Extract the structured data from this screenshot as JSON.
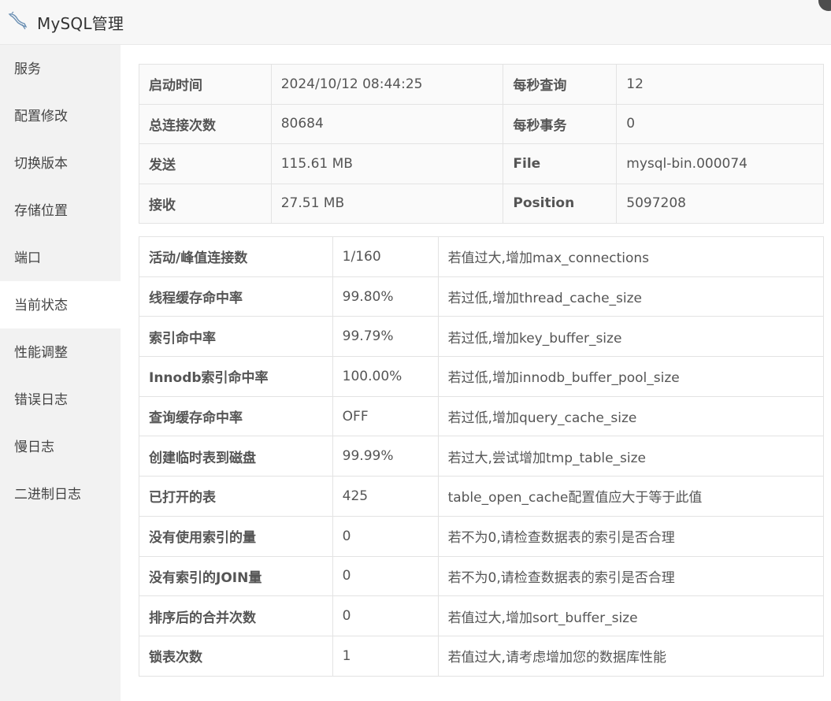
{
  "app": {
    "title": "MySQL管理"
  },
  "sidebar": {
    "items": [
      {
        "label": "服务"
      },
      {
        "label": "配置修改"
      },
      {
        "label": "切换版本"
      },
      {
        "label": "存储位置"
      },
      {
        "label": "端口"
      },
      {
        "label": "当前状态",
        "active": true
      },
      {
        "label": "性能调整"
      },
      {
        "label": "错误日志"
      },
      {
        "label": "慢日志"
      },
      {
        "label": "二进制日志"
      }
    ]
  },
  "summary": {
    "rows": [
      {
        "k1": "启动时间",
        "v1": "2024/10/12 08:44:25",
        "k2": "每秒查询",
        "v2": "12"
      },
      {
        "k1": "总连接次数",
        "v1": "80684",
        "k2": "每秒事务",
        "v2": "0"
      },
      {
        "k1": "发送",
        "v1": "115.61 MB",
        "k2": "File",
        "v2": "mysql-bin.000074"
      },
      {
        "k1": "接收",
        "v1": "27.51 MB",
        "k2": "Position",
        "v2": "5097208"
      }
    ]
  },
  "metrics": {
    "rows": [
      {
        "name": "活动/峰值连接数",
        "value": "1/160",
        "advice": "若值过大,增加max_connections"
      },
      {
        "name": "线程缓存命中率",
        "value": "99.80%",
        "advice": "若过低,增加thread_cache_size"
      },
      {
        "name": "索引命中率",
        "value": "99.79%",
        "advice": "若过低,增加key_buffer_size"
      },
      {
        "name": "Innodb索引命中率",
        "value": "100.00%",
        "advice": "若过低,增加innodb_buffer_pool_size"
      },
      {
        "name": "查询缓存命中率",
        "value": "OFF",
        "advice": "若过低,增加query_cache_size"
      },
      {
        "name": "创建临时表到磁盘",
        "value": "99.99%",
        "advice": "若过大,尝试增加tmp_table_size"
      },
      {
        "name": "已打开的表",
        "value": "425",
        "advice": "table_open_cache配置值应大于等于此值"
      },
      {
        "name": "没有使用索引的量",
        "value": "0",
        "advice": "若不为0,请检查数据表的索引是否合理"
      },
      {
        "name": "没有索引的JOIN量",
        "value": "0",
        "advice": "若不为0,请检查数据表的索引是否合理"
      },
      {
        "name": "排序后的合并次数",
        "value": "0",
        "advice": "若值过大,增加sort_buffer_size"
      },
      {
        "name": "锁表次数",
        "value": "1",
        "advice": "若值过大,请考虑增加您的数据库性能"
      }
    ]
  }
}
